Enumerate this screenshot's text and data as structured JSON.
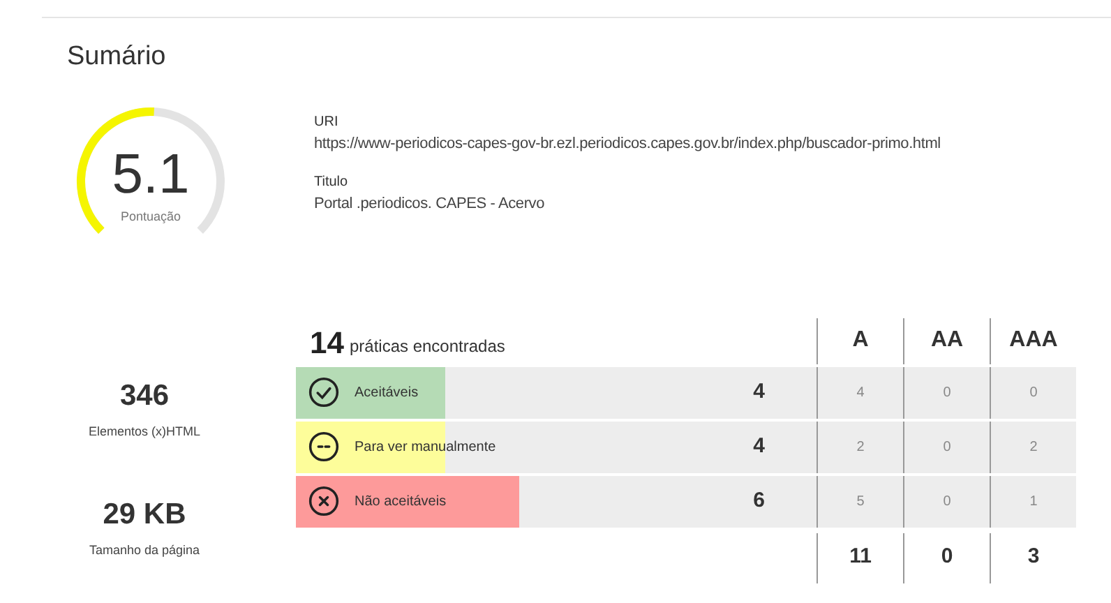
{
  "title": "Sumário",
  "score": {
    "value": "5.1",
    "label": "Pontuação"
  },
  "info": [
    {
      "label": "URI",
      "value": "https://www-periodicos-capes-gov-br.ezl.periodicos.capes.gov.br/index.php/buscador-primo.html"
    },
    {
      "label": "Titulo",
      "value": "Portal .periodicos. CAPES - Acervo"
    }
  ],
  "stats": [
    {
      "value": "346",
      "label": "Elementos (x)HTML"
    },
    {
      "value": "29 KB",
      "label": "Tamanho da página"
    }
  ],
  "practices": {
    "count": "14",
    "label": "práticas encontradas",
    "columns": [
      "A",
      "AA",
      "AAA"
    ],
    "rows": [
      {
        "kind": "ok",
        "label": "Aceitáveis",
        "count": "4",
        "level": 0.286,
        "color": "#b5dbb5",
        "levels": [
          "4",
          "0",
          "0"
        ]
      },
      {
        "kind": "manual",
        "label": "Para ver manualmente",
        "count": "4",
        "level": 0.286,
        "color": "#fdfd9a",
        "levels": [
          "2",
          "0",
          "2"
        ]
      },
      {
        "kind": "fail",
        "label": "Não aceitáveis",
        "count": "6",
        "level": 0.429,
        "color": "#fd9a9a",
        "levels": [
          "5",
          "0",
          "1"
        ]
      }
    ],
    "totals": [
      "11",
      "0",
      "3"
    ]
  }
}
